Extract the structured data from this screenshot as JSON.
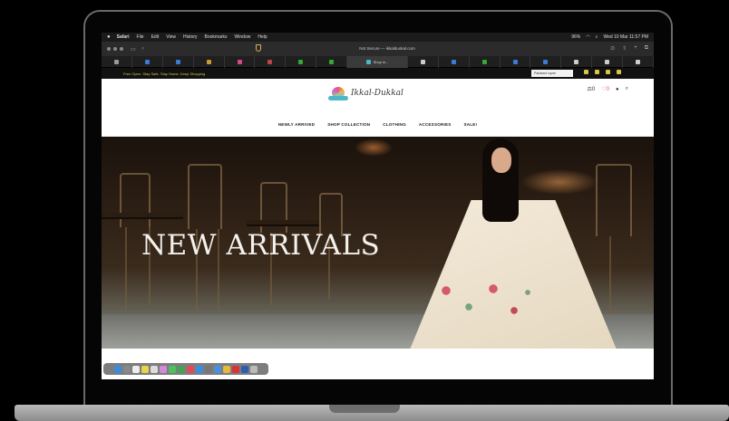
{
  "menubar": {
    "items": [
      "Safari",
      "File",
      "Edit",
      "View",
      "History",
      "Bookmarks",
      "Window",
      "Help"
    ],
    "battery": "96%",
    "clock": "Wed 10 Mar 11:57 PM"
  },
  "browser": {
    "address": "Not Secure — ikkalduokal.com",
    "active_tab_label": "Shop in..."
  },
  "site": {
    "announcement": "Free Open. Stay Safe. Stay Home. Keep Shopping",
    "currency_select": "Pakistani rupee",
    "logo_text": "Ikkal-Dukkal",
    "cart_count": "0",
    "wishlist_count": "0",
    "nav": [
      "NEWLY ARRIVED",
      "SHOP COLLECTION",
      "CLOTHING",
      "ACCESSORIES",
      "SALE!"
    ],
    "hero_title": "NEW ARRIVALS"
  },
  "colors": {
    "announcement_text": "#d6c54a",
    "logo_accent": "#4db7c8",
    "wishlist_icon": "#e0507e"
  }
}
